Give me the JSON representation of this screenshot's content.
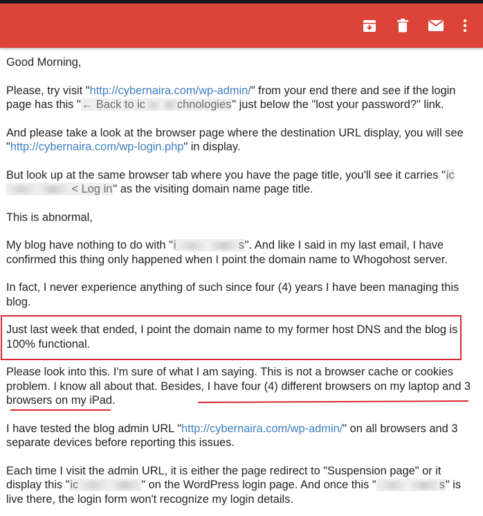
{
  "colors": {
    "accent": "#db4437",
    "link": "#3f7fbf",
    "annotation_red": "#d8272f"
  },
  "toolbar": {
    "icons": [
      "archive-icon",
      "trash-icon",
      "mail-icon",
      "more-vert-icon"
    ]
  },
  "email": {
    "greeting": "Good Morning,",
    "p1": {
      "a": "Please, try visit \"",
      "link": "http://cybernaira.com/wp-admin/",
      "b": "\" from your end there and see if the login page has this \"",
      "chip_pre": "← Back to ic",
      "chip_post": "chnologies",
      "c": "\" just below the \"lost your password?\" link."
    },
    "p2": {
      "a": "And please take a look at the browser page where the destination URL display, you will see \"",
      "link": "http://cybernaira.com/wp-login.php",
      "b": "\" in display."
    },
    "p3": {
      "a": "But look up at the same browser tab where you have the page title, you'll see it carries \"",
      "chip_pre": "ic",
      "chip_post": " < Log in",
      "b": "\" as the visiting domain name page title."
    },
    "p4": "This is abnormal,",
    "p5": {
      "a": "My blog have nothing to do with \"",
      "chip_pre": "i",
      "chip_post": "s",
      "b": "\". And like I said in my last email, I have confirmed this thing only happened when I point the domain name to Whogohost server."
    },
    "p6": "In fact, I never experience anything of such since four (4) years I have been managing this blog.",
    "p7": "Just last week that ended, I point the domain name to my former host DNS and the blog is 100% functional.",
    "p8": "Please look into this. I'm sure of what I am saying. This is not a browser cache or cookies problem. I know all about that. Besides, I have four (4) different browsers on my laptop and 3 browsers on my iPad.",
    "p9": {
      "a": "I have tested the blog admin URL \"",
      "link": "http://cybernaira.com/wp-admin/",
      "b": "\" on all browsers and 3 separate devices before reporting this issues."
    },
    "p10": {
      "a": "Each time I visit the admin URL, it is either the page redirect to \"Suspension page\" or it display this \"",
      "chip_pre": "ic",
      "chip_post": "",
      "b": "\" on the WordPress login page. And once this \"",
      "chip2_pre": "",
      "chip2_post": "s",
      "c": "\" is live there, the login form won't recognize my login details."
    }
  }
}
